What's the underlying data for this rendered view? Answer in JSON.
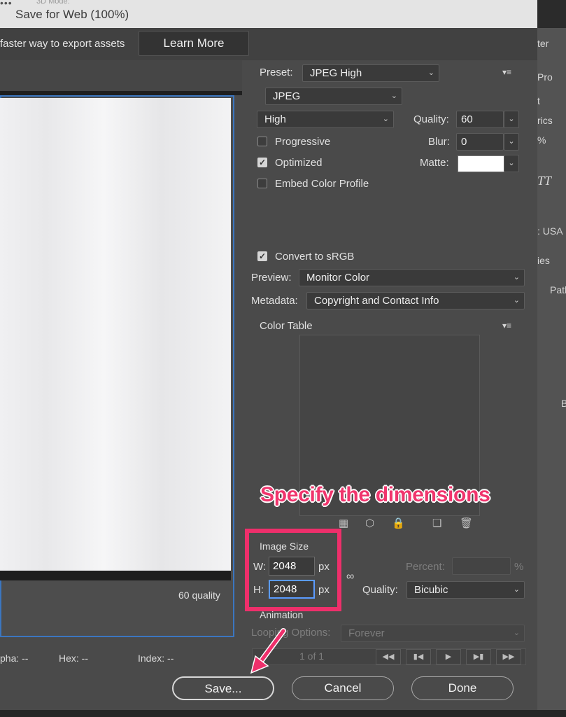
{
  "window": {
    "title": "Save for Web (100%)",
    "ghost_menu": "3D Mode:"
  },
  "banner": {
    "text": "faster way to export assets",
    "learn_more": "Learn More"
  },
  "preview": {
    "quality_label": "60 quality"
  },
  "statusbar": {
    "alpha": "pha: --",
    "hex": "Hex: --",
    "index": "Index: --"
  },
  "settings": {
    "preset_label": "Preset:",
    "preset_value": "JPEG High",
    "format_value": "JPEG",
    "compression_value": "High",
    "quality_label": "Quality:",
    "quality_value": "60",
    "blur_label": "Blur:",
    "blur_value": "0",
    "matte_label": "Matte:",
    "matte_color": "#ffffff",
    "progressive": "Progressive",
    "optimized": "Optimized",
    "embed_profile": "Embed Color Profile",
    "convert_srgb": "Convert to sRGB",
    "preview_label": "Preview:",
    "preview_value": "Monitor Color",
    "metadata_label": "Metadata:",
    "metadata_value": "Copyright and Contact Info",
    "color_table": "Color Table"
  },
  "image_size": {
    "title": "Image Size",
    "w_label": "W:",
    "w_value": "2048",
    "h_label": "H:",
    "h_value": "2048",
    "unit": "px",
    "percent_label": "Percent:",
    "percent_sign": "%",
    "quality_label": "Quality:",
    "quality_value": "Bicubic"
  },
  "animation": {
    "title": "Animation",
    "looping_label": "Looping Options:",
    "looping_value": "Forever",
    "frame": "1 of 1"
  },
  "annotation": {
    "text": "Specify the dimensions",
    "color": "#f0356d"
  },
  "buttons": {
    "save": "Save...",
    "cancel": "Cancel",
    "done": "Done"
  },
  "ps_panel": {
    "t1": "ter",
    "t2": "Pro",
    "t3": "t",
    "t4": "rics",
    "t5": "%",
    "t6": "TT",
    "t7": ": USA",
    "t8": "ies",
    "t9": "Path",
    "t10": "B"
  }
}
